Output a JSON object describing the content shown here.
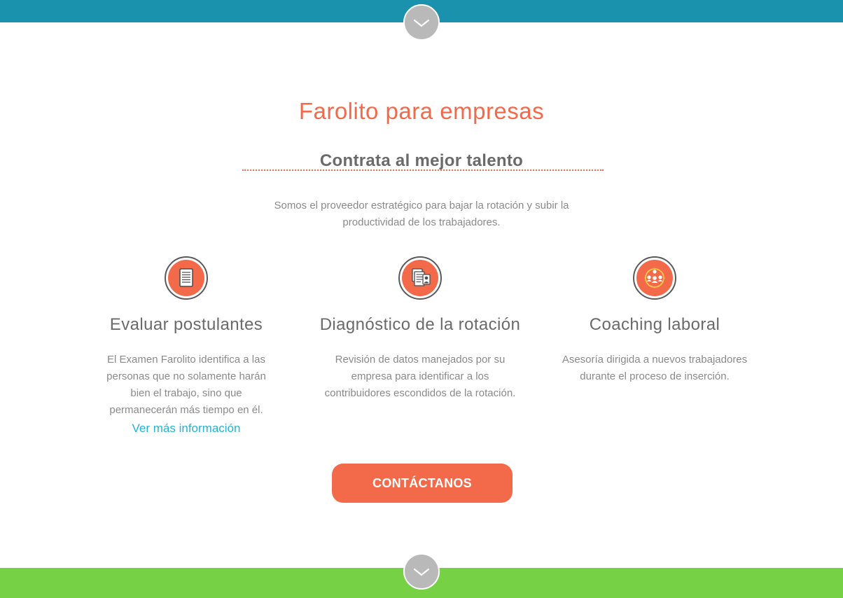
{
  "section": {
    "title": "Farolito para empresas",
    "subtitle": "Contrata al mejor talento",
    "intro": "Somos el proveedor estratégico para bajar la rotación y subir la productividad de los trabajadores."
  },
  "features": [
    {
      "icon": "document-icon",
      "title": "Evaluar postulantes",
      "description": "El Examen Farolito identifica a las personas que no solamente harán bien el trabajo, sino que permanecerán más tiempo en él.",
      "link": "Ver más información"
    },
    {
      "icon": "document-person-icon",
      "title": "Diagnóstico de la rotación",
      "description": "Revisión de datos manejados por su empresa para identificar a los contribuidores escondidos de la rotación."
    },
    {
      "icon": "team-circle-icon",
      "title": "Coaching laboral",
      "description": "Asesoría dirigida a nuevos trabajadores durante el proceso de inserción."
    }
  ],
  "cta": {
    "label": "CONTÁCTANOS"
  },
  "colors": {
    "accent": "#f36a4a",
    "link": "#23b4cf",
    "top_band": "#1a92ae",
    "bottom_band": "#76d244",
    "scroll_button": "#b9b9b9"
  }
}
